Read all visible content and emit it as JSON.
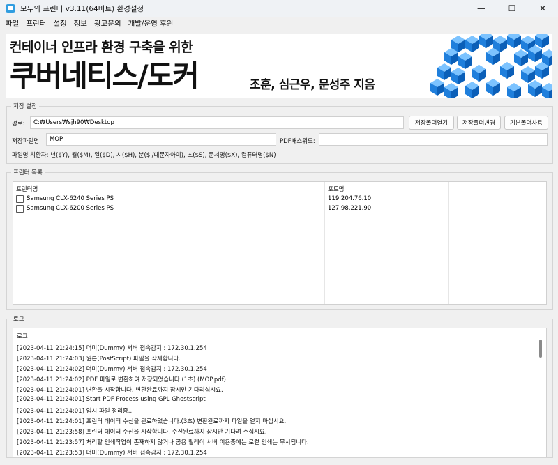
{
  "window": {
    "title": "모두의 프린터 v3.11(64비트) 환경설정",
    "controls": {
      "minimize": "—",
      "maximize": "☐",
      "close": "✕"
    }
  },
  "menu": [
    "파일",
    "프린터",
    "설정",
    "정보",
    "광고문의",
    "개발/운영 후원"
  ],
  "banner": {
    "subtitle": "컨테이너 인프라 환경 구축을 위한",
    "title": "쿠버네티스/도커",
    "authors": "조훈, 심근우, 문성주 지음",
    "accent": "#2e8be0"
  },
  "storage": {
    "group_title": "저장 설정",
    "path_label": "경로:",
    "path_value": "C:₩Users₩sjh90₩Desktop",
    "open_folder": "저장폴더열기",
    "change_folder": "저장폴더변경",
    "default_folder": "기본폴더사용",
    "filename_label": "저장파일명:",
    "filename_value": "MOP",
    "pdf_password_label": "PDF패스워드:",
    "pdf_password_value": "",
    "substitutes": "파일명 치환자: 년($Y), 월($M), 일($D), 시($H), 분($I/대문자아이), 초($S), 문서명($X), 컴퓨터명($N)"
  },
  "printers": {
    "group_title": "프린터 목록",
    "headers": {
      "name": "프린터명",
      "port": "포트명"
    },
    "rows": [
      {
        "name": "Samsung CLX-6240 Series PS",
        "port": "119.204.76.10"
      },
      {
        "name": "Samsung CLX-6200 Series PS",
        "port": "127.98.221.90"
      }
    ]
  },
  "log": {
    "group_title": "로그",
    "header": "로그",
    "lines": [
      "[2023-04-11 21:24:15] 더미(Dummy) 서버 접속감지 : 172.30.1.254",
      "[2023-04-11 21:24:03] 원본(PostScript) 파일을 삭제합니다.",
      "[2023-04-11 21:24:02] 더미(Dummy) 서버 접속감지 : 172.30.1.254",
      "[2023-04-11 21:24:02] PDF 파일로 변환하여 저장되었습니다.(1초) (MOP.pdf)",
      "[2023-04-11 21:24:01] 변환을 시작합니다. 변환완료까지 잠시만 기다리십시요.",
      "[2023-04-11 21:24:01] Start PDF Process using GPL Ghostscript",
      "[2023-04-11 21:24:01] 임시 파일 정리중..",
      "[2023-04-11 21:24:01] 프린터 데이터 수신을 완료하였습니다.(3초) 변환완료까지 파일을 열지 마십시요.",
      "[2023-04-11 21:23:58] 프린터 데이터 수신을 시작합니다. 수신완료까지 잠시만 기다려 주십시요.",
      "[2023-04-11 21:23:57] 처리할 인쇄작업이 존재하지 않거나 공용 릴레이 서버 이용중에는 로컬 인쇄는 무시됩니다.",
      "[2023-04-11 21:23:53] 더미(Dummy) 서버 접속감지 : 172.30.1.254"
    ]
  }
}
